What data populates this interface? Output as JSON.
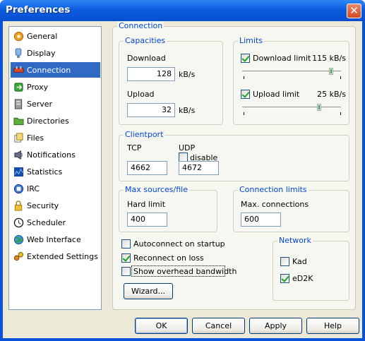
{
  "window": {
    "title": "Preferences",
    "close_glyph": "✕"
  },
  "sidebar": {
    "items": [
      {
        "label": "General",
        "icon": "gear-icon"
      },
      {
        "label": "Display",
        "icon": "display-icon"
      },
      {
        "label": "Connection",
        "icon": "connection-icon",
        "selected": true
      },
      {
        "label": "Proxy",
        "icon": "proxy-icon"
      },
      {
        "label": "Server",
        "icon": "server-icon"
      },
      {
        "label": "Directories",
        "icon": "folder-icon"
      },
      {
        "label": "Files",
        "icon": "files-icon"
      },
      {
        "label": "Notifications",
        "icon": "notifications-icon"
      },
      {
        "label": "Statistics",
        "icon": "statistics-icon"
      },
      {
        "label": "IRC",
        "icon": "irc-icon"
      },
      {
        "label": "Security",
        "icon": "lock-icon"
      },
      {
        "label": "Scheduler",
        "icon": "clock-icon"
      },
      {
        "label": "Web Interface",
        "icon": "globe-icon"
      },
      {
        "label": "Extended Settings",
        "icon": "extended-settings-icon"
      }
    ]
  },
  "connection": {
    "group_title": "Connection",
    "capacities": {
      "title": "Capacities",
      "download_label": "Download",
      "download_value": "128",
      "upload_label": "Upload",
      "upload_value": "32",
      "unit": "kB/s"
    },
    "limits": {
      "title": "Limits",
      "download_limit_label": "Download limit",
      "download_limit_checked": true,
      "download_limit_value": "115 kB/s",
      "download_slider_fraction": 0.9,
      "upload_limit_label": "Upload limit",
      "upload_limit_checked": true,
      "upload_limit_value": "25 kB/s",
      "upload_slider_fraction": 0.78
    },
    "clientport": {
      "title": "Clientport",
      "tcp_label": "TCP",
      "tcp_value": "4662",
      "udp_label": "UDP",
      "udp_disable_label": "disable",
      "udp_disable_checked": false,
      "udp_value": "4672"
    },
    "max_sources": {
      "title": "Max sources/file",
      "hard_limit_label": "Hard limit",
      "hard_limit_value": "400"
    },
    "connection_limits": {
      "title": "Connection limits",
      "max_connections_label": "Max. connections",
      "max_connections_value": "600"
    },
    "options": {
      "autoconnect_label": "Autoconnect on startup",
      "autoconnect_checked": false,
      "reconnect_label": "Reconnect on loss",
      "reconnect_checked": true,
      "overhead_label": "Show overhead bandwidth",
      "overhead_checked": false
    },
    "network": {
      "title": "Network",
      "kad_label": "Kad",
      "kad_checked": false,
      "ed2k_label": "eD2K",
      "ed2k_checked": true
    },
    "wizard_label": "Wizard..."
  },
  "buttons": {
    "ok": "OK",
    "cancel": "Cancel",
    "apply": "Apply",
    "help": "Help"
  }
}
